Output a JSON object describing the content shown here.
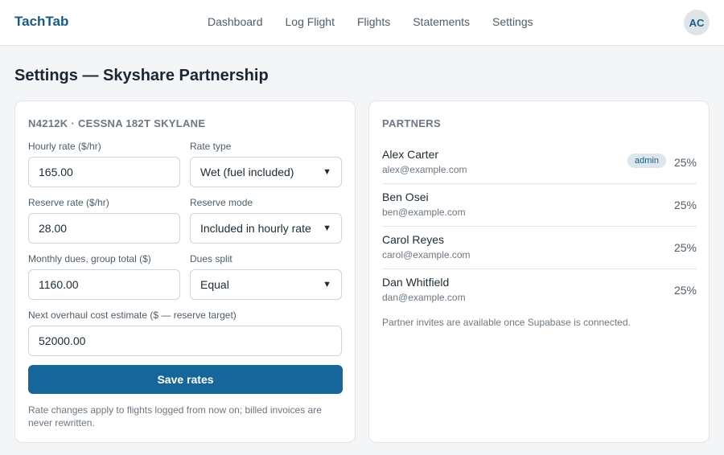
{
  "app": {
    "name": "TachTab",
    "avatar_initials": "AC"
  },
  "nav": {
    "items": [
      {
        "label": "Dashboard"
      },
      {
        "label": "Log Flight"
      },
      {
        "label": "Flights"
      },
      {
        "label": "Statements"
      },
      {
        "label": "Settings"
      }
    ]
  },
  "page": {
    "title": "Settings — Skyshare Partnership"
  },
  "aircraft": {
    "heading": "N4212K · CESSNA 182T SKYLANE",
    "hourly_rate": {
      "label": "Hourly rate ($/hr)",
      "value": "165.00"
    },
    "rate_type": {
      "label": "Rate type",
      "value": "Wet (fuel included)"
    },
    "reserve_rate": {
      "label": "Reserve rate ($/hr)",
      "value": "28.00"
    },
    "reserve_mode": {
      "label": "Reserve mode",
      "value": "Included in hourly rate"
    },
    "monthly_dues": {
      "label": "Monthly dues, group total ($)",
      "value": "1160.00"
    },
    "dues_split": {
      "label": "Dues split",
      "value": "Equal"
    },
    "overhaul": {
      "label": "Next overhaul cost estimate ($ — reserve target)",
      "value": "52000.00"
    },
    "save_label": "Save rates",
    "note": "Rate changes apply to flights logged from now on; billed invoices are never rewritten."
  },
  "partners": {
    "heading": "PARTNERS",
    "items": [
      {
        "name": "Alex Carter",
        "email": "alex@example.com",
        "share": "25%",
        "badge": "admin"
      },
      {
        "name": "Ben Osei",
        "email": "ben@example.com",
        "share": "25%"
      },
      {
        "name": "Carol Reyes",
        "email": "carol@example.com",
        "share": "25%"
      },
      {
        "name": "Dan Whitfield",
        "email": "dan@example.com",
        "share": "25%"
      }
    ],
    "invite_note": "Partner invites are available once Supabase is connected."
  },
  "colors": {
    "brand": "#185b86",
    "primary_button": "#17669a"
  }
}
